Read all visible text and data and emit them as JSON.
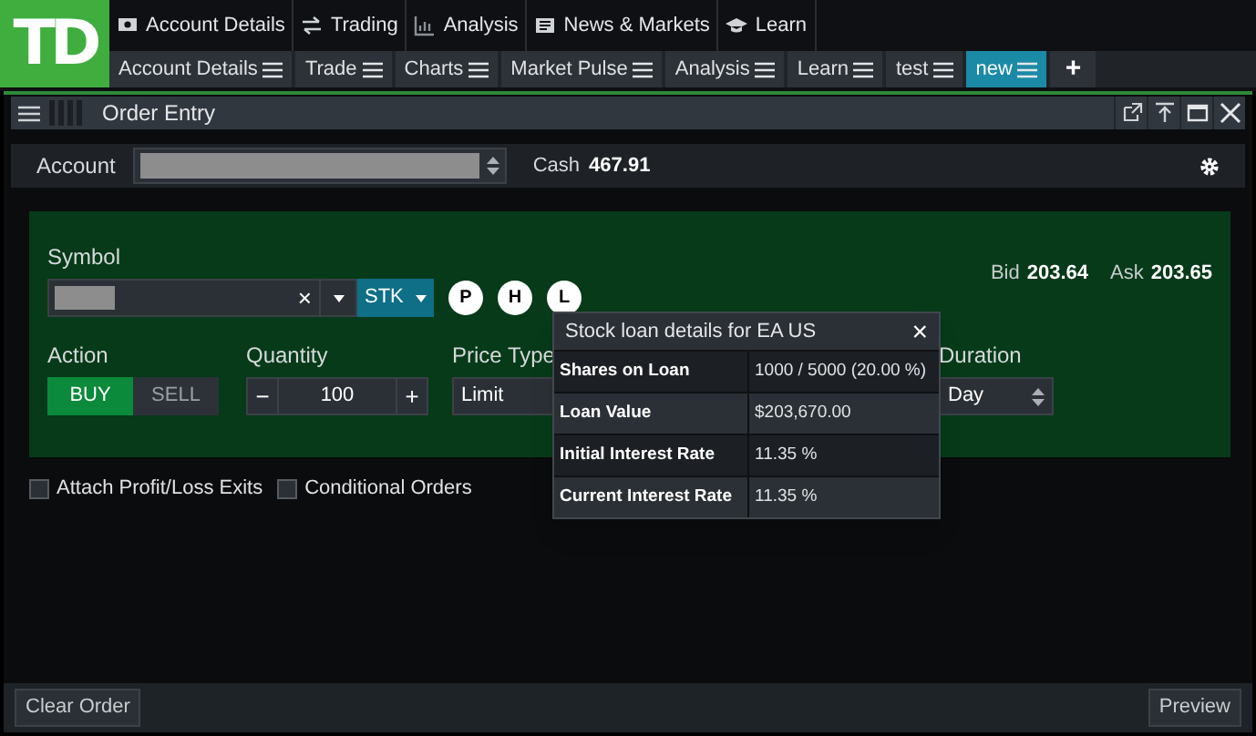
{
  "logo": {
    "text": "TD"
  },
  "top_menu": [
    {
      "label": "Account Details"
    },
    {
      "label": "Trading"
    },
    {
      "label": "Analysis"
    },
    {
      "label": "News & Markets"
    },
    {
      "label": "Learn"
    }
  ],
  "tabs": [
    {
      "label": "Account Details",
      "selected": false
    },
    {
      "label": "Trade",
      "selected": false
    },
    {
      "label": "Charts",
      "selected": false
    },
    {
      "label": "Market Pulse",
      "selected": false
    },
    {
      "label": "Analysis",
      "selected": false
    },
    {
      "label": "Learn",
      "selected": false
    },
    {
      "label": "test",
      "selected": false
    },
    {
      "label": "new",
      "selected": true
    }
  ],
  "add_tab": "+",
  "panel": {
    "title": "Order Entry"
  },
  "account": {
    "label": "Account",
    "cash_label": "Cash",
    "cash_value": "467.91"
  },
  "symbol": {
    "label": "Symbol",
    "clear": "×",
    "type": "STK",
    "badges": [
      "P",
      "H",
      "L"
    ]
  },
  "quote": {
    "bid_label": "Bid",
    "bid": "203.64",
    "ask_label": "Ask",
    "ask": "203.65"
  },
  "action": {
    "label": "Action",
    "buttons": [
      {
        "label": "BUY",
        "selected": true
      },
      {
        "label": "SELL",
        "selected": false
      }
    ]
  },
  "quantity": {
    "label": "Quantity",
    "minus": "−",
    "value": "100",
    "plus": "+"
  },
  "price_type": {
    "label": "Price Type",
    "value": "Limit"
  },
  "duration": {
    "label": "Duration",
    "value": "Day"
  },
  "options": [
    {
      "label": "Attach Profit/Loss Exits",
      "checked": false
    },
    {
      "label": "Conditional Orders",
      "checked": false
    }
  ],
  "popup": {
    "title": "Stock loan details for EA US",
    "close": "×",
    "rows": [
      {
        "label": "Shares on Loan",
        "value": "1000 / 5000 (20.00 %)"
      },
      {
        "label": "Loan Value",
        "value": "$203,670.00"
      },
      {
        "label": "Initial Interest Rate",
        "value": "11.35 %"
      },
      {
        "label": "Current Interest Rate",
        "value": "11.35 %"
      }
    ]
  },
  "footer": {
    "buttons": [
      "Clear Order",
      "Preview"
    ]
  }
}
